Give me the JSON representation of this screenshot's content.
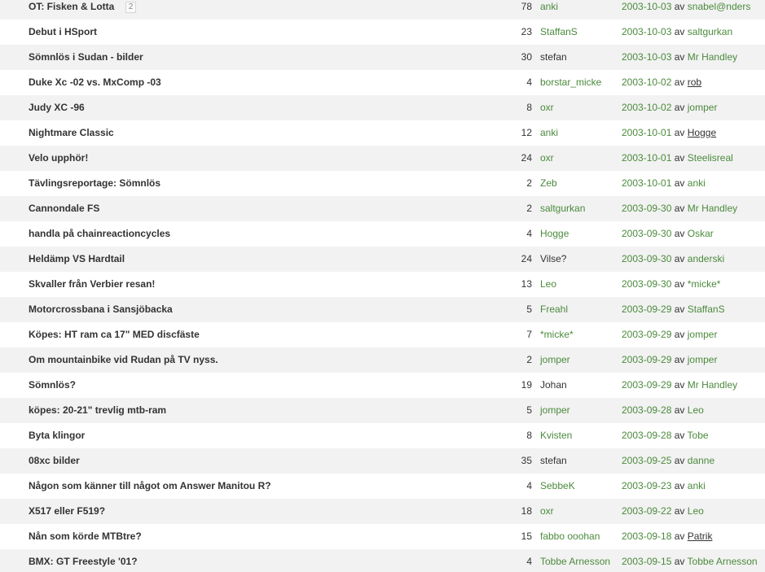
{
  "av_label": "av",
  "rows": [
    {
      "title": "OT: Fisken & Lotta",
      "pages": "2",
      "replies": "78",
      "author": "anki",
      "author_link": true,
      "date": "2003-10-03",
      "last_by": "snabel@nders",
      "last_link": true
    },
    {
      "title": "Debut i HSport",
      "replies": "23",
      "author": "StaffanS",
      "author_link": true,
      "date": "2003-10-03",
      "last_by": "saltgurkan",
      "last_link": true
    },
    {
      "title": "Sömnlös i Sudan - bilder",
      "replies": "30",
      "author": "stefan",
      "author_link": false,
      "date": "2003-10-03",
      "last_by": "Mr Handley",
      "last_link": true
    },
    {
      "title": "Duke Xc -02 vs. MxComp -03",
      "replies": "4",
      "author": "borstar_micke",
      "author_link": true,
      "date": "2003-10-02",
      "last_by": "rob",
      "last_link": false
    },
    {
      "title": "Judy XC -96",
      "replies": "8",
      "author": "oxr",
      "author_link": true,
      "date": "2003-10-02",
      "last_by": "jomper",
      "last_link": true
    },
    {
      "title": "Nightmare Classic",
      "replies": "12",
      "author": "anki",
      "author_link": true,
      "date": "2003-10-01",
      "last_by": "Hogge",
      "last_link": false
    },
    {
      "title": "Velo upphör!",
      "replies": "24",
      "author": "oxr",
      "author_link": true,
      "date": "2003-10-01",
      "last_by": "Steelisreal",
      "last_link": true
    },
    {
      "title": "Tävlingsreportage: Sömnlös",
      "replies": "2",
      "author": "Zeb",
      "author_link": true,
      "date": "2003-10-01",
      "last_by": "anki",
      "last_link": true
    },
    {
      "title": "Cannondale FS",
      "replies": "2",
      "author": "saltgurkan",
      "author_link": true,
      "date": "2003-09-30",
      "last_by": "Mr Handley",
      "last_link": true
    },
    {
      "title": "handla på chainreactioncycles",
      "replies": "4",
      "author": "Hogge",
      "author_link": true,
      "date": "2003-09-30",
      "last_by": "Oskar",
      "last_link": true
    },
    {
      "title": "Heldämp VS Hardtail",
      "replies": "24",
      "author": "Vilse?",
      "author_link": false,
      "date": "2003-09-30",
      "last_by": "anderski",
      "last_link": true
    },
    {
      "title": "Skvaller från Verbier resan!",
      "replies": "13",
      "author": "Leo",
      "author_link": true,
      "date": "2003-09-30",
      "last_by": "*micke*",
      "last_link": true
    },
    {
      "title": "Motorcrossbana i Sansjöbacka",
      "replies": "5",
      "author": "Freahl",
      "author_link": true,
      "date": "2003-09-29",
      "last_by": "StaffanS",
      "last_link": true
    },
    {
      "title": "Köpes: HT ram ca 17\" MED discfäste",
      "replies": "7",
      "author": "*micke*",
      "author_link": true,
      "date": "2003-09-29",
      "last_by": "jomper",
      "last_link": true
    },
    {
      "title": "Om mountainbike vid Rudan på TV nyss.",
      "replies": "2",
      "author": "jomper",
      "author_link": true,
      "date": "2003-09-29",
      "last_by": "jomper",
      "last_link": true
    },
    {
      "title": "Sömnlös?",
      "replies": "19",
      "author": "Johan",
      "author_link": false,
      "date": "2003-09-29",
      "last_by": "Mr Handley",
      "last_link": true
    },
    {
      "title": "köpes: 20-21\" trevlig mtb-ram",
      "replies": "5",
      "author": "jomper",
      "author_link": true,
      "date": "2003-09-28",
      "last_by": "Leo",
      "last_link": true
    },
    {
      "title": "Byta klingor",
      "replies": "8",
      "author": "Kvisten",
      "author_link": true,
      "date": "2003-09-28",
      "last_by": "Tobe",
      "last_link": true
    },
    {
      "title": "08xc bilder",
      "replies": "35",
      "author": "stefan",
      "author_link": false,
      "date": "2003-09-25",
      "last_by": "danne",
      "last_link": true
    },
    {
      "title": "Någon som känner till något om Answer Manitou R?",
      "replies": "4",
      "author": "SebbeK",
      "author_link": true,
      "date": "2003-09-23",
      "last_by": "anki",
      "last_link": true
    },
    {
      "title": "X517 eller F519?",
      "replies": "18",
      "author": "oxr",
      "author_link": true,
      "date": "2003-09-22",
      "last_by": "Leo",
      "last_link": true
    },
    {
      "title": "Nån som körde MTBtre?",
      "replies": "15",
      "author": "fabbo ooohan",
      "author_link": true,
      "date": "2003-09-18",
      "last_by": "Patrik",
      "last_link": false
    },
    {
      "title": "BMX: GT Freestyle '01?",
      "replies": "4",
      "author": "Tobbe Arnesson",
      "author_link": true,
      "date": "2003-09-15",
      "last_by": "Tobbe Arnesson",
      "last_link": true
    }
  ]
}
